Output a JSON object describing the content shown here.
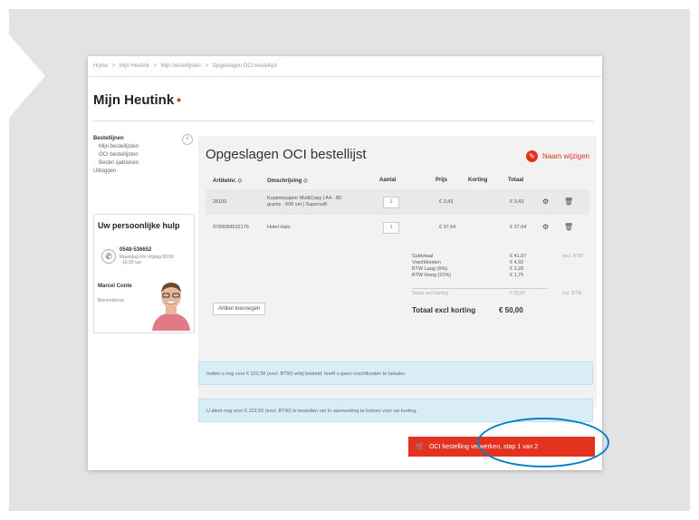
{
  "breadcrumb": [
    "Home",
    ">",
    "Mijn Heutink",
    ">",
    "Mijn bestellijsten",
    ">",
    "Opgeslagen OCI bestellijst"
  ],
  "page_title": "Mijn Heutink",
  "sidebar": {
    "heading": "Bestellijnen",
    "items": [
      "Mijn bestellijsten",
      "OCI bestellijsten",
      "Bestel sjablonen"
    ],
    "logout": "Uitloggen",
    "collapse_icon": "chevron-up-icon"
  },
  "help": {
    "title": "Uw persoonlijke hulp",
    "phone": "0548-536652",
    "hours": "Maandag t/m Vrijdag 08:00 - 16:30 uur",
    "contact_name": "Marcel Conte",
    "department": "Binnendienst"
  },
  "main": {
    "title": "Opgeslagen OCI bestellijst",
    "rename_label": "Naam wijzigen",
    "columns": {
      "article": "Artikelnr. ◇",
      "description": "Omschrijving ◇",
      "qty": "Aantal",
      "price": "Prijs",
      "discount": "Korting",
      "total": "Totaal"
    },
    "rows": [
      {
        "article": "28100",
        "desc1": "Kopieerpapier MultiCopy | A4 - 80",
        "desc2": "grams - 500 vel | Supersoft",
        "qty": "1",
        "price": "€ 3,43",
        "total": "€ 3,43"
      },
      {
        "article": "9789089532176",
        "desc1": "Hotel Halo",
        "desc2": "",
        "qty": "1",
        "price": "€ 37,64",
        "total": "€ 37,64"
      }
    ],
    "summary_labels": [
      "Subtotaal",
      "Vrachtkosten",
      "BTW Laag (6%)",
      "BTW Hoog (21%)"
    ],
    "summary_values": [
      "€ 41,07",
      "€ 4,92",
      "€ 2,26",
      "€ 1,75"
    ],
    "summary_note": "excl. BTW",
    "total_excl_label": "Totaal excl korting",
    "total_excl_value": "€ 50,00",
    "total_excl_note": "incl. BTW",
    "grand_label": "Totaal excl korting",
    "grand_value": "€ 50,00",
    "add_article": "Artikel toevoegen"
  },
  "info1": "Indien u nog voor € 102,56 (excl. BTW) erbij besteld, hoeft u geen vrachtkosten te betalen.",
  "info2": "U dient nog voor € 102,56 (excl. BTW) te bestellen om in aanmerking te komen voor uw korting.",
  "cta_label": "OCI bestelling verwerken, stap 1 van 2",
  "colors": {
    "accent": "#e3321f",
    "info_bg": "#d9edf7",
    "highlight": "#0080c9"
  }
}
